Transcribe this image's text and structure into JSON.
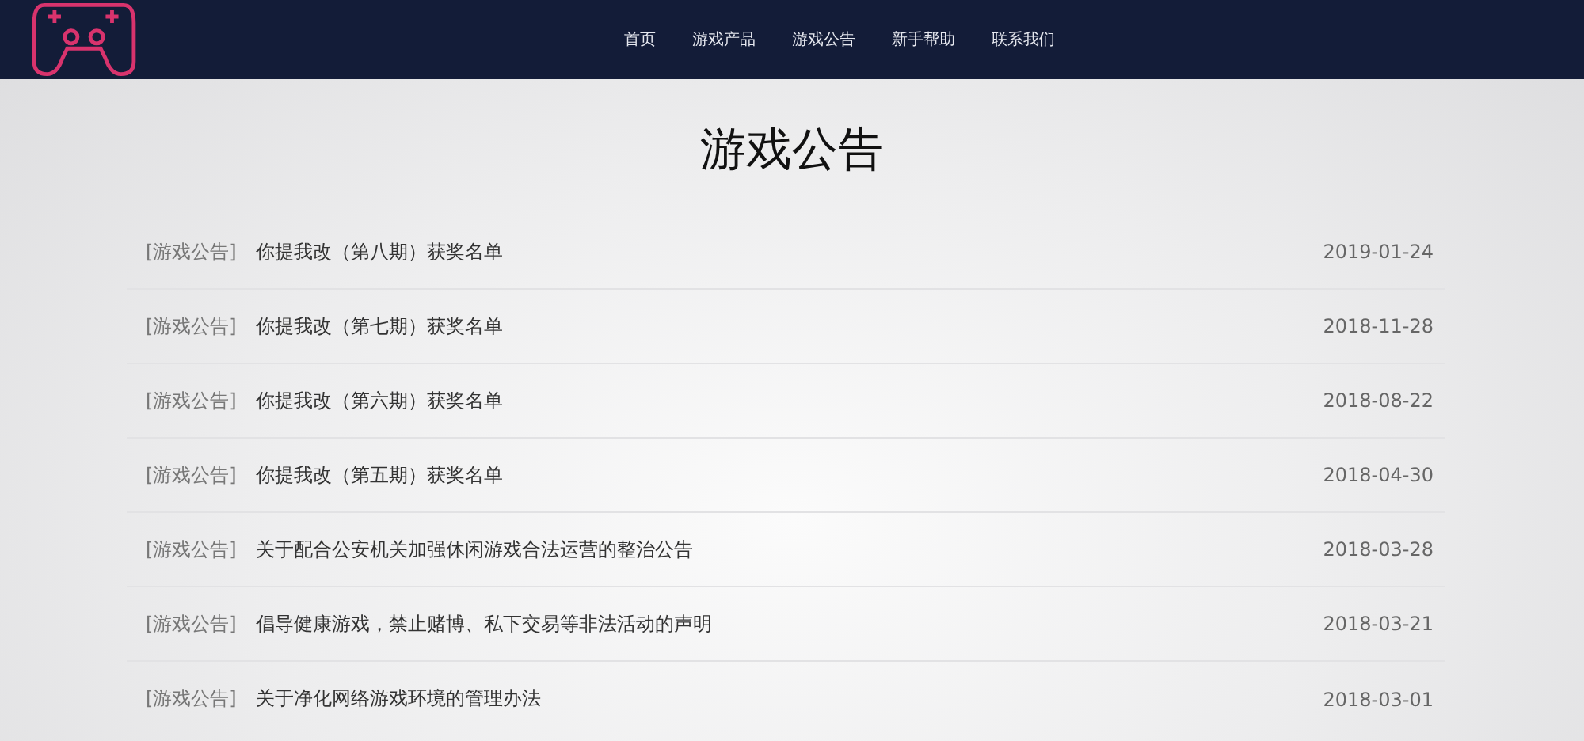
{
  "nav": [
    {
      "label": "首页"
    },
    {
      "label": "游戏产品"
    },
    {
      "label": "游戏公告"
    },
    {
      "label": "新手帮助"
    },
    {
      "label": "联系我们"
    }
  ],
  "heading": "游戏公告",
  "notices": [
    {
      "category": "[游戏公告]",
      "title": "你提我改（第八期）获奖名单",
      "date": "2019-01-24"
    },
    {
      "category": "[游戏公告]",
      "title": "你提我改（第七期）获奖名单",
      "date": "2018-11-28"
    },
    {
      "category": "[游戏公告]",
      "title": "你提我改（第六期）获奖名单",
      "date": "2018-08-22"
    },
    {
      "category": "[游戏公告]",
      "title": "你提我改（第五期）获奖名单",
      "date": "2018-04-30"
    },
    {
      "category": "[游戏公告]",
      "title": "关于配合公安机关加强休闲游戏合法运营的整治公告",
      "date": "2018-03-28"
    },
    {
      "category": "[游戏公告]",
      "title": "倡导健康游戏，禁止赌博、私下交易等非法活动的声明",
      "date": "2018-03-21"
    },
    {
      "category": "[游戏公告]",
      "title": "关于净化网络游戏环境的管理办法",
      "date": "2018-03-01"
    }
  ]
}
